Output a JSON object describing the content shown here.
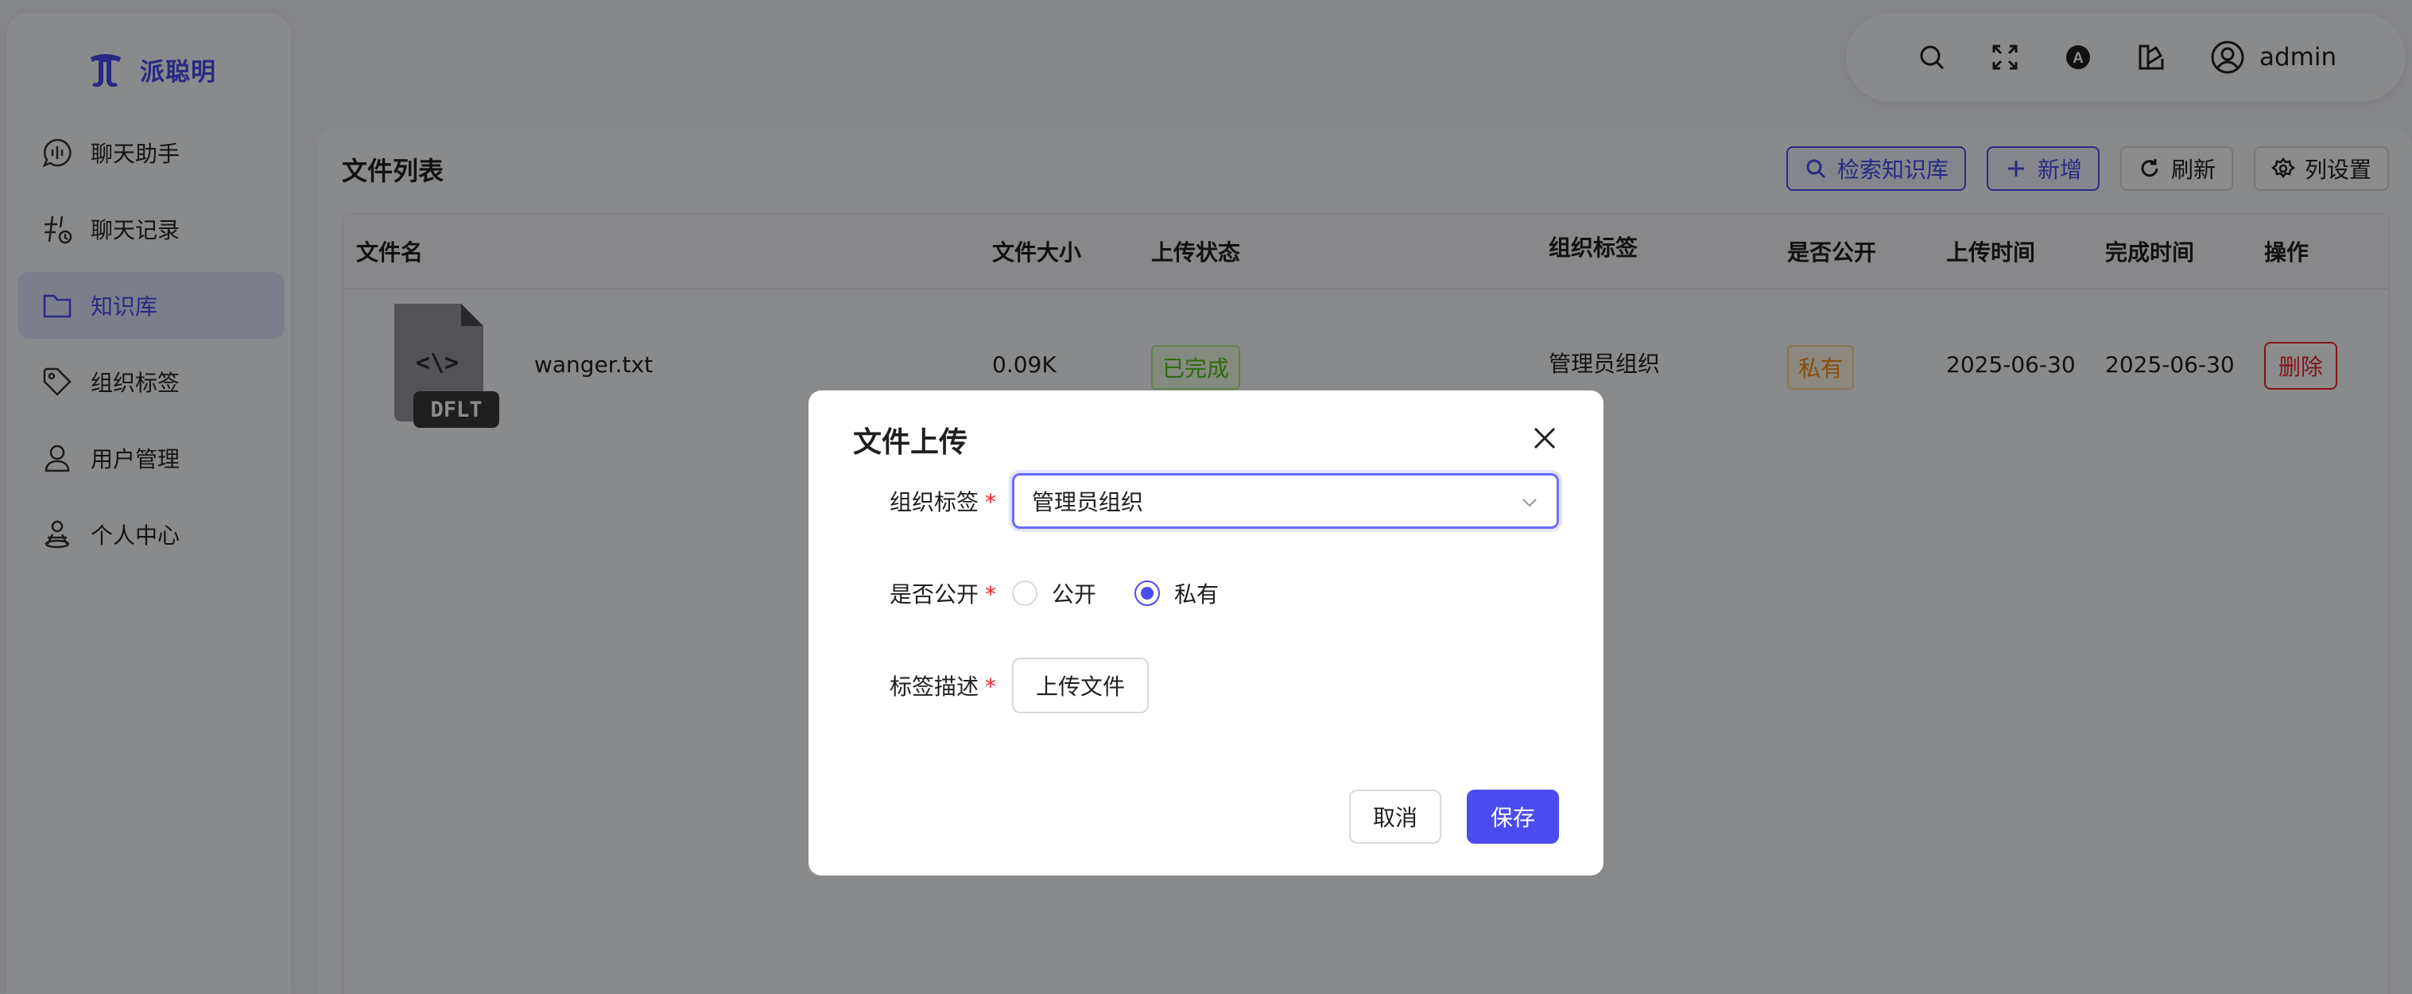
{
  "app": {
    "brand": "派聪明"
  },
  "sidebar": {
    "items": [
      {
        "label": "聊天助手",
        "icon": "chat-bubble-icon",
        "active": false
      },
      {
        "label": "聊天记录",
        "icon": "hash-icon",
        "active": false
      },
      {
        "label": "知识库",
        "icon": "folder-icon",
        "active": true
      },
      {
        "label": "组织标签",
        "icon": "tag-icon",
        "active": false
      },
      {
        "label": "用户管理",
        "icon": "user-icon",
        "active": false
      },
      {
        "label": "个人中心",
        "icon": "person-center-icon",
        "active": false
      }
    ]
  },
  "header": {
    "icons": [
      "search-icon",
      "fullscreen-icon",
      "language-icon",
      "theme-icon"
    ],
    "username": "admin"
  },
  "main": {
    "title": "文件列表",
    "toolbar": {
      "search_kb": "检索知识库",
      "add": "新增",
      "refresh": "刷新",
      "columns": "列设置"
    },
    "table": {
      "columns": [
        "文件名",
        "文件大小",
        "上传状态",
        "组织标签",
        "是否公开",
        "上传时间",
        "完成时间",
        "操作"
      ],
      "rows": [
        {
          "file_badge": "DFLT",
          "file_glyph": "<\\>",
          "name": "wanger.txt",
          "size": "0.09K",
          "status": "已完成",
          "org_tag": "管理员组织",
          "visibility": "私有",
          "upload_time": "2025-06-30",
          "done_time": "2025-06-30",
          "action": "删除"
        }
      ]
    }
  },
  "modal": {
    "title": "文件上传",
    "org_label": "组织标签",
    "org_value": "管理员组织",
    "public_label": "是否公开",
    "option_public": "公开",
    "option_private": "私有",
    "selected": "private",
    "desc_label": "标签描述",
    "upload_button": "上传文件",
    "cancel": "取消",
    "save": "保存",
    "required_mark": "*"
  },
  "colors": {
    "accent": "#4b4cf0",
    "success": "#52c41a",
    "warning": "#fa8c16",
    "danger": "#f5222d"
  }
}
